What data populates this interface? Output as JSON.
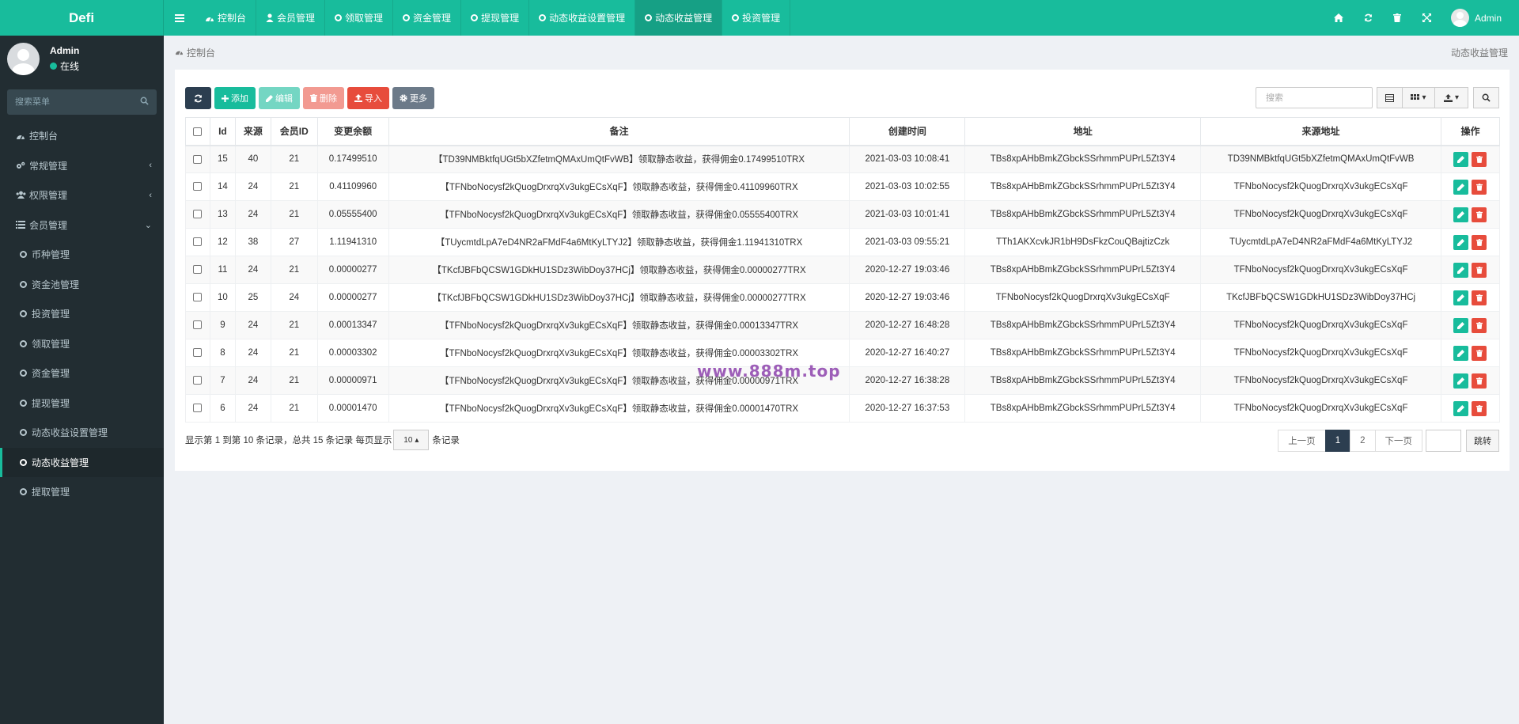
{
  "brand": "Defi",
  "user": {
    "name": "Admin",
    "status": "在线"
  },
  "sidebar": {
    "search_placeholder": "搜索菜单",
    "items": [
      {
        "label": "控制台",
        "icon": "dashboard-icon"
      },
      {
        "label": "常规管理",
        "icon": "cogs-icon"
      },
      {
        "label": "权限管理",
        "icon": "users-icon"
      },
      {
        "label": "会员管理",
        "icon": "list-icon"
      },
      {
        "label": "币种管理"
      },
      {
        "label": "资金池管理"
      },
      {
        "label": "投资管理"
      },
      {
        "label": "领取管理"
      },
      {
        "label": "资金管理"
      },
      {
        "label": "提现管理"
      },
      {
        "label": "动态收益设置管理"
      },
      {
        "label": "动态收益管理"
      },
      {
        "label": "提取管理"
      }
    ]
  },
  "topnav": {
    "tabs": [
      "控制台",
      "会员管理",
      "领取管理",
      "资金管理",
      "提现管理",
      "动态收益设置管理",
      "动态收益管理",
      "投资管理"
    ],
    "user": "Admin"
  },
  "content": {
    "breadcrumb": "控制台",
    "page_title": "动态收益管理"
  },
  "toolbar": {
    "add": "添加",
    "edit": "编辑",
    "delete": "删除",
    "import": "导入",
    "more": "更多",
    "search_placeholder": "搜索"
  },
  "table": {
    "headers": [
      "Id",
      "来源",
      "会员ID",
      "变更余额",
      "备注",
      "创建时间",
      "地址",
      "来源地址",
      "操作"
    ],
    "rows": [
      [
        "15",
        "40",
        "21",
        "0.17499510",
        "【TD39NMBktfqUGt5bXZfetmQMAxUmQtFvWB】领取静态收益，获得佣金0.17499510TRX",
        "2021-03-03 10:08:41",
        "TBs8xpAHbBmkZGbckSSrhmmPUPrL5Zt3Y4",
        "TD39NMBktfqUGt5bXZfetmQMAxUmQtFvWB"
      ],
      [
        "14",
        "24",
        "21",
        "0.41109960",
        "【TFNboNocysf2kQuogDrxrqXv3ukgECsXqF】领取静态收益，获得佣金0.41109960TRX",
        "2021-03-03 10:02:55",
        "TBs8xpAHbBmkZGbckSSrhmmPUPrL5Zt3Y4",
        "TFNboNocysf2kQuogDrxrqXv3ukgECsXqF"
      ],
      [
        "13",
        "24",
        "21",
        "0.05555400",
        "【TFNboNocysf2kQuogDrxrqXv3ukgECsXqF】领取静态收益，获得佣金0.05555400TRX",
        "2021-03-03 10:01:41",
        "TBs8xpAHbBmkZGbckSSrhmmPUPrL5Zt3Y4",
        "TFNboNocysf2kQuogDrxrqXv3ukgECsXqF"
      ],
      [
        "12",
        "38",
        "27",
        "1.11941310",
        "【TUycmtdLpA7eD4NR2aFMdF4a6MtKyLTYJ2】领取静态收益，获得佣金1.11941310TRX",
        "2021-03-03 09:55:21",
        "TTh1AKXcvkJR1bH9DsFkzCouQBajtizCzk",
        "TUycmtdLpA7eD4NR2aFMdF4a6MtKyLTYJ2"
      ],
      [
        "11",
        "24",
        "21",
        "0.00000277",
        "【TKcfJBFbQCSW1GDkHU1SDz3WibDoy37HCj】领取静态收益，获得佣金0.00000277TRX",
        "2020-12-27 19:03:46",
        "TBs8xpAHbBmkZGbckSSrhmmPUPrL5Zt3Y4",
        "TFNboNocysf2kQuogDrxrqXv3ukgECsXqF"
      ],
      [
        "10",
        "25",
        "24",
        "0.00000277",
        "【TKcfJBFbQCSW1GDkHU1SDz3WibDoy37HCj】领取静态收益，获得佣金0.00000277TRX",
        "2020-12-27 19:03:46",
        "TFNboNocysf2kQuogDrxrqXv3ukgECsXqF",
        "TKcfJBFbQCSW1GDkHU1SDz3WibDoy37HCj"
      ],
      [
        "9",
        "24",
        "21",
        "0.00013347",
        "【TFNboNocysf2kQuogDrxrqXv3ukgECsXqF】领取静态收益，获得佣金0.00013347TRX",
        "2020-12-27 16:48:28",
        "TBs8xpAHbBmkZGbckSSrhmmPUPrL5Zt3Y4",
        "TFNboNocysf2kQuogDrxrqXv3ukgECsXqF"
      ],
      [
        "8",
        "24",
        "21",
        "0.00003302",
        "【TFNboNocysf2kQuogDrxrqXv3ukgECsXqF】领取静态收益，获得佣金0.00003302TRX",
        "2020-12-27 16:40:27",
        "TBs8xpAHbBmkZGbckSSrhmmPUPrL5Zt3Y4",
        "TFNboNocysf2kQuogDrxrqXv3ukgECsXqF"
      ],
      [
        "7",
        "24",
        "21",
        "0.00000971",
        "【TFNboNocysf2kQuogDrxrqXv3ukgECsXqF】领取静态收益，获得佣金0.00000971TRX",
        "2020-12-27 16:38:28",
        "TBs8xpAHbBmkZGbckSSrhmmPUPrL5Zt3Y4",
        "TFNboNocysf2kQuogDrxrqXv3ukgECsXqF"
      ],
      [
        "6",
        "24",
        "21",
        "0.00001470",
        "【TFNboNocysf2kQuogDrxrqXv3ukgECsXqF】领取静态收益，获得佣金0.00001470TRX",
        "2020-12-27 16:37:53",
        "TBs8xpAHbBmkZGbckSSrhmmPUPrL5Zt3Y4",
        "TFNboNocysf2kQuogDrxrqXv3ukgECsXqF"
      ]
    ]
  },
  "pagination": {
    "summary": "显示第 1 到第 10 条记录，总共 15 条记录 每页显示",
    "page_size": "10",
    "suffix": "条记录",
    "prev": "上一页",
    "pages": [
      "1",
      "2"
    ],
    "next": "下一页",
    "go": "跳转"
  },
  "watermark": "www.888m.top",
  "colors": {
    "primary": "#18bc9c",
    "sidebar": "#222d32",
    "danger": "#e74c3c",
    "dark": "#2c3e50"
  }
}
